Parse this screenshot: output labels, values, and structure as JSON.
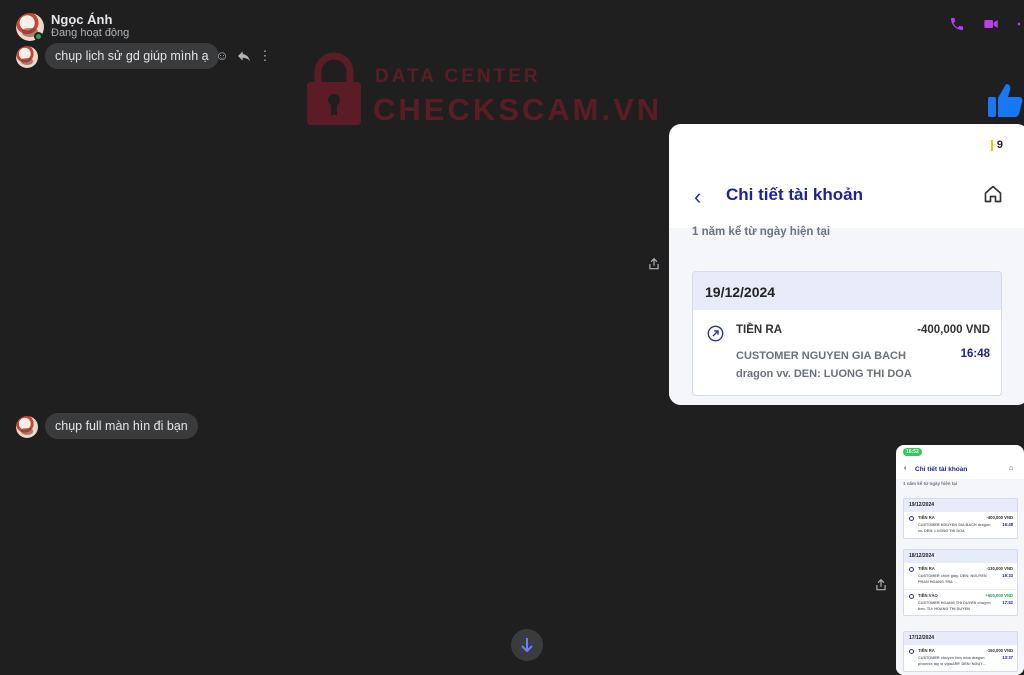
{
  "header": {
    "name": "Ngọc Ánh",
    "status": "Đang hoạt động",
    "icons": [
      "phone-icon",
      "video-call-icon",
      "more-icon"
    ],
    "accent_color": "#b73ff0"
  },
  "messages": [
    {
      "text": "chụp lịch sử gd giúp mình ạ",
      "actions": [
        "emoji-icon",
        "reply-icon",
        "more-icon"
      ]
    },
    {
      "text": "chụp full màn hìn đi bạn"
    }
  ],
  "watermark": {
    "small": "DATA CENTER",
    "big": "CHECKSCAM.VN",
    "color": "#8c1b2a"
  },
  "reaction": "thumbs-up-icon",
  "screenshot_1": {
    "signal": "9",
    "title": "Chi tiết tài khoản",
    "range": "1 năm kể từ ngày hiện tại",
    "date": "19/12/2024",
    "type": "TIỀN RA",
    "amount": "-400,000 VND",
    "description": "CUSTOMER NGUYEN GIA BACH dragon vv. DEN: LUONG THI DOA",
    "time": "16:48"
  },
  "screenshot_2": {
    "clock": "16:52",
    "title": "Chi tiết tài khoản",
    "range": "1 năm kể từ ngày hiện tại",
    "groups": [
      {
        "date": "19/12/2024",
        "items": [
          {
            "type": "TIỀN RA",
            "amount": "-400,000 VND",
            "desc": "CUSTOMER NGUYEN GIA BACH dragon vv. DEN: LUONG THI DOA",
            "time": "16:48",
            "dir": "out"
          }
        ]
      },
      {
        "date": "18/12/2024",
        "items": [
          {
            "type": "TIỀN RA",
            "amount": "-130,000 VND",
            "desc": "CUSTOMER chiết giày. DEN: NGUYEN PHAN HOANG TRA",
            "time": "19:33",
            "dir": "out"
          },
          {
            "type": "TIỀN VÀO",
            "amount": "+600,000 VND",
            "desc": "CUSTOMER HOANG THI DUYEN chuyen tien. TU: HOANG THI DUYEN",
            "time": "17:52",
            "dir": "in"
          }
        ]
      },
      {
        "date": "17/12/2024",
        "items": [
          {
            "type": "TIỀN RA",
            "amount": "-150,000 VND",
            "desc": "CUSTOMER chuyen tien mua dragon phoenix tay vị vịpaARF. DEN: NGUY...",
            "time": "13:37",
            "dir": "out"
          }
        ]
      }
    ]
  }
}
